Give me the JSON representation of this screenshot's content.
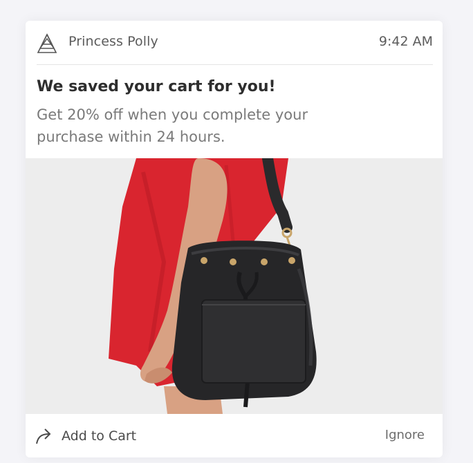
{
  "notification": {
    "app_name": "Princess Polly",
    "time": "9:42 AM",
    "title": "We saved your cart for you!",
    "body": "Get 20% off when you complete your purchase within 24 hours.",
    "image_subject": "black leather bucket bag worn by model in red dress",
    "actions": {
      "primary_label": "Add to Cart",
      "secondary_label": "Ignore"
    }
  },
  "icons": {
    "logo": "triangle-logo-icon",
    "add_to_cart": "share-arrow-icon"
  },
  "colors": {
    "card_bg": "#ffffff",
    "page_bg": "#f4f4f8",
    "dress": "#d9252f",
    "bag": "#262628",
    "text_dark": "#2e2e2e",
    "text_muted": "#7a7a7a"
  }
}
